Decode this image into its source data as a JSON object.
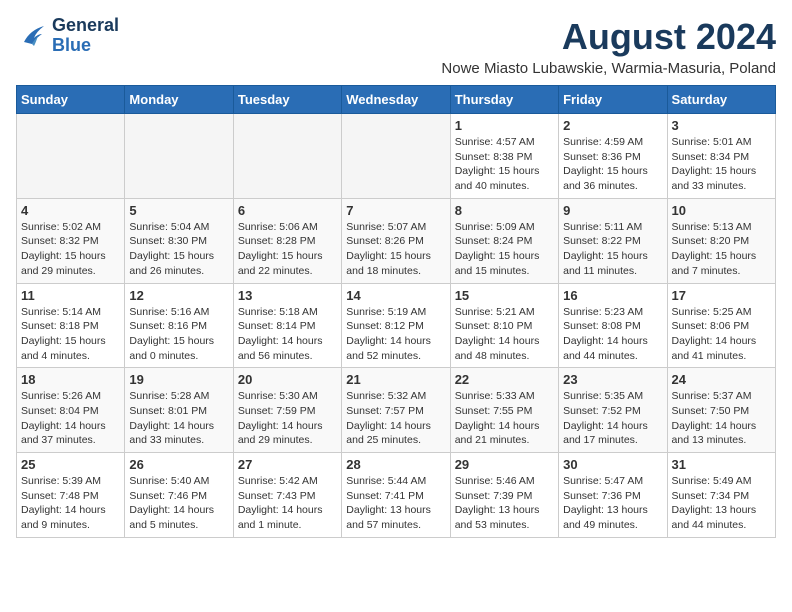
{
  "logo": {
    "line1": "General",
    "line2": "Blue"
  },
  "title": "August 2024",
  "subtitle": "Nowe Miasto Lubawskie, Warmia-Masuria, Poland",
  "weekdays": [
    "Sunday",
    "Monday",
    "Tuesday",
    "Wednesday",
    "Thursday",
    "Friday",
    "Saturday"
  ],
  "weeks": [
    [
      {
        "day": "",
        "info": ""
      },
      {
        "day": "",
        "info": ""
      },
      {
        "day": "",
        "info": ""
      },
      {
        "day": "",
        "info": ""
      },
      {
        "day": "1",
        "info": "Sunrise: 4:57 AM\nSunset: 8:38 PM\nDaylight: 15 hours\nand 40 minutes."
      },
      {
        "day": "2",
        "info": "Sunrise: 4:59 AM\nSunset: 8:36 PM\nDaylight: 15 hours\nand 36 minutes."
      },
      {
        "day": "3",
        "info": "Sunrise: 5:01 AM\nSunset: 8:34 PM\nDaylight: 15 hours\nand 33 minutes."
      }
    ],
    [
      {
        "day": "4",
        "info": "Sunrise: 5:02 AM\nSunset: 8:32 PM\nDaylight: 15 hours\nand 29 minutes."
      },
      {
        "day": "5",
        "info": "Sunrise: 5:04 AM\nSunset: 8:30 PM\nDaylight: 15 hours\nand 26 minutes."
      },
      {
        "day": "6",
        "info": "Sunrise: 5:06 AM\nSunset: 8:28 PM\nDaylight: 15 hours\nand 22 minutes."
      },
      {
        "day": "7",
        "info": "Sunrise: 5:07 AM\nSunset: 8:26 PM\nDaylight: 15 hours\nand 18 minutes."
      },
      {
        "day": "8",
        "info": "Sunrise: 5:09 AM\nSunset: 8:24 PM\nDaylight: 15 hours\nand 15 minutes."
      },
      {
        "day": "9",
        "info": "Sunrise: 5:11 AM\nSunset: 8:22 PM\nDaylight: 15 hours\nand 11 minutes."
      },
      {
        "day": "10",
        "info": "Sunrise: 5:13 AM\nSunset: 8:20 PM\nDaylight: 15 hours\nand 7 minutes."
      }
    ],
    [
      {
        "day": "11",
        "info": "Sunrise: 5:14 AM\nSunset: 8:18 PM\nDaylight: 15 hours\nand 4 minutes."
      },
      {
        "day": "12",
        "info": "Sunrise: 5:16 AM\nSunset: 8:16 PM\nDaylight: 15 hours\nand 0 minutes."
      },
      {
        "day": "13",
        "info": "Sunrise: 5:18 AM\nSunset: 8:14 PM\nDaylight: 14 hours\nand 56 minutes."
      },
      {
        "day": "14",
        "info": "Sunrise: 5:19 AM\nSunset: 8:12 PM\nDaylight: 14 hours\nand 52 minutes."
      },
      {
        "day": "15",
        "info": "Sunrise: 5:21 AM\nSunset: 8:10 PM\nDaylight: 14 hours\nand 48 minutes."
      },
      {
        "day": "16",
        "info": "Sunrise: 5:23 AM\nSunset: 8:08 PM\nDaylight: 14 hours\nand 44 minutes."
      },
      {
        "day": "17",
        "info": "Sunrise: 5:25 AM\nSunset: 8:06 PM\nDaylight: 14 hours\nand 41 minutes."
      }
    ],
    [
      {
        "day": "18",
        "info": "Sunrise: 5:26 AM\nSunset: 8:04 PM\nDaylight: 14 hours\nand 37 minutes."
      },
      {
        "day": "19",
        "info": "Sunrise: 5:28 AM\nSunset: 8:01 PM\nDaylight: 14 hours\nand 33 minutes."
      },
      {
        "day": "20",
        "info": "Sunrise: 5:30 AM\nSunset: 7:59 PM\nDaylight: 14 hours\nand 29 minutes."
      },
      {
        "day": "21",
        "info": "Sunrise: 5:32 AM\nSunset: 7:57 PM\nDaylight: 14 hours\nand 25 minutes."
      },
      {
        "day": "22",
        "info": "Sunrise: 5:33 AM\nSunset: 7:55 PM\nDaylight: 14 hours\nand 21 minutes."
      },
      {
        "day": "23",
        "info": "Sunrise: 5:35 AM\nSunset: 7:52 PM\nDaylight: 14 hours\nand 17 minutes."
      },
      {
        "day": "24",
        "info": "Sunrise: 5:37 AM\nSunset: 7:50 PM\nDaylight: 14 hours\nand 13 minutes."
      }
    ],
    [
      {
        "day": "25",
        "info": "Sunrise: 5:39 AM\nSunset: 7:48 PM\nDaylight: 14 hours\nand 9 minutes."
      },
      {
        "day": "26",
        "info": "Sunrise: 5:40 AM\nSunset: 7:46 PM\nDaylight: 14 hours\nand 5 minutes."
      },
      {
        "day": "27",
        "info": "Sunrise: 5:42 AM\nSunset: 7:43 PM\nDaylight: 14 hours\nand 1 minute."
      },
      {
        "day": "28",
        "info": "Sunrise: 5:44 AM\nSunset: 7:41 PM\nDaylight: 13 hours\nand 57 minutes."
      },
      {
        "day": "29",
        "info": "Sunrise: 5:46 AM\nSunset: 7:39 PM\nDaylight: 13 hours\nand 53 minutes."
      },
      {
        "day": "30",
        "info": "Sunrise: 5:47 AM\nSunset: 7:36 PM\nDaylight: 13 hours\nand 49 minutes."
      },
      {
        "day": "31",
        "info": "Sunrise: 5:49 AM\nSunset: 7:34 PM\nDaylight: 13 hours\nand 44 minutes."
      }
    ]
  ]
}
